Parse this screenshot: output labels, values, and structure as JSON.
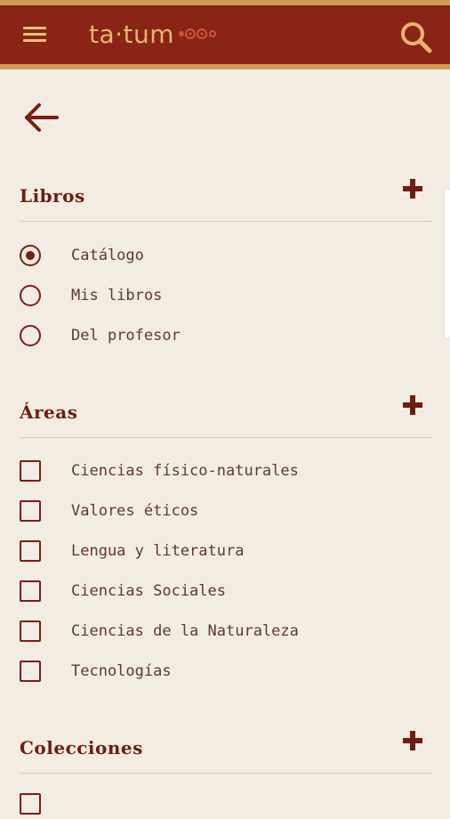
{
  "app": {
    "logo_text": "ta·tum",
    "brand_colors": {
      "topbar": "#8a2416",
      "accent": "#d39a54"
    }
  },
  "header": {
    "menu_icon": "hamburger-menu-icon",
    "search_icon": "search-icon"
  },
  "navigation": {
    "back_icon": "arrow-left-icon"
  },
  "sections": {
    "libros": {
      "title": "Libros",
      "add_icon": "plus-icon",
      "options": [
        {
          "label": "Catálogo",
          "checked": true
        },
        {
          "label": "Mis libros",
          "checked": false
        },
        {
          "label": "Del profesor",
          "checked": false
        }
      ]
    },
    "areas": {
      "title": "Áreas",
      "add_icon": "plus-icon",
      "options": [
        {
          "label": "Ciencias físico-naturales",
          "checked": false
        },
        {
          "label": "Valores éticos",
          "checked": false
        },
        {
          "label": "Lengua y literatura",
          "checked": false
        },
        {
          "label": "Ciencias Sociales",
          "checked": false
        },
        {
          "label": "Ciencias de la Naturaleza",
          "checked": false
        },
        {
          "label": "Tecnologías",
          "checked": false
        }
      ]
    },
    "colecciones": {
      "title": "Colecciones",
      "add_icon": "plus-icon"
    }
  }
}
